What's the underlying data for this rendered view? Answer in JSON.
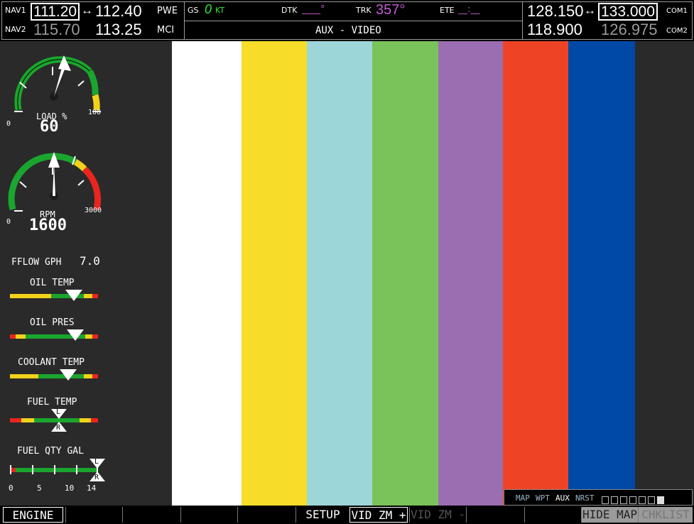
{
  "nav": {
    "nav1_label": "NAV1",
    "nav1_active": "111.20",
    "nav1_swap": "↔",
    "nav1_standby": "112.40",
    "nav1_id": "PWE",
    "nav2_label": "NAV2",
    "nav2_active": "115.70",
    "nav2_standby": "113.25",
    "nav2_id": "MCI"
  },
  "data_bar": {
    "gs_label": "GS",
    "gs_value": "0",
    "gs_unit": "KT",
    "dtk_label": "DTK",
    "dtk_value": "____°",
    "trk_label": "TRK",
    "trk_value": "357°",
    "ete_label": "ETE",
    "ete_value": "__:__",
    "page_title": "AUX - VIDEO"
  },
  "com": {
    "com1_active": "128.150",
    "com1_swap": "↔",
    "com1_standby": "133.000",
    "com1_label": "COM1",
    "com2_active": "118.900",
    "com2_standby": "126.975",
    "com2_label": "COM2"
  },
  "engine": {
    "load": {
      "label": "LOAD %",
      "value": "60",
      "min": "0",
      "max": "100",
      "fraction": 0.6
    },
    "rpm": {
      "label": "RPM",
      "value": "1600",
      "min": "0",
      "max": "3000",
      "fraction": 0.53
    },
    "fflow": {
      "label": "FFLOW GPH",
      "value": "7.0"
    },
    "oil_temp": {
      "label": "OIL TEMP",
      "fraction": 0.6
    },
    "oil_pres": {
      "label": "OIL PRES",
      "fraction": 0.6
    },
    "coolant_temp": {
      "label": "COOLANT TEMP",
      "fraction": 0.52
    },
    "fuel_temp": {
      "label": "FUEL TEMP",
      "left_marker": "L",
      "right_marker": "R",
      "fraction": 0.52
    },
    "fuel_qty": {
      "label": "FUEL QTY GAL",
      "left_marker": "L",
      "right_marker": "R",
      "ticks": [
        "0",
        "5",
        "10",
        "14"
      ],
      "fraction": 1.0
    }
  },
  "colors": {
    "stripes": [
      "#ffffff",
      "#f7dc2a",
      "#9dd6d9",
      "#79c35a",
      "#9a6eb0",
      "#ef4326",
      "#0049a6",
      "#2a2a2a"
    ],
    "gauge_green": "#1aa62e",
    "gauge_yellow": "#f2d21b",
    "gauge_red": "#e8251e"
  },
  "page_group": {
    "items": [
      "MAP",
      "WPT",
      "AUX",
      "NRST"
    ],
    "active": "AUX"
  },
  "softkeys": {
    "engine": "ENGINE",
    "setup": "SETUP",
    "vid_zm_plus": "VID ZM +",
    "vid_zm_minus": "VID ZM -",
    "hide_map": "HIDE MAP",
    "chklist": "CHKLIST"
  }
}
